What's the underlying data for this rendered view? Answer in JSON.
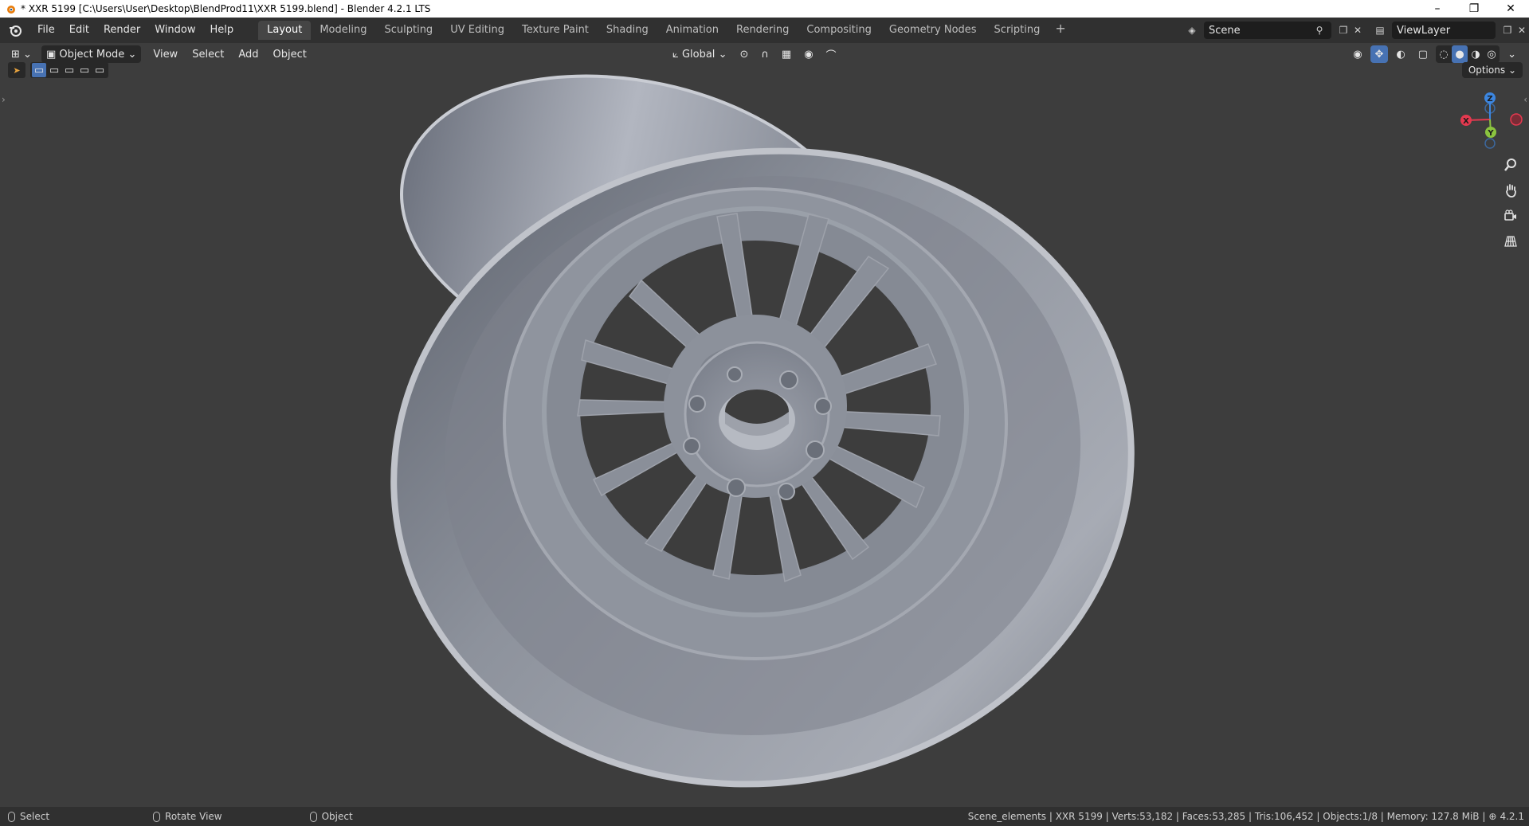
{
  "window": {
    "title": "* XXR 5199 [C:\\Users\\User\\Desktop\\BlendProd11\\XXR 5199.blend] - Blender 4.2.1 LTS",
    "minimize": "–",
    "restore": "❐",
    "close": "✕"
  },
  "topbar": {
    "menus": [
      "File",
      "Edit",
      "Render",
      "Window",
      "Help"
    ],
    "workspaces": [
      "Layout",
      "Modeling",
      "Sculpting",
      "UV Editing",
      "Texture Paint",
      "Shading",
      "Animation",
      "Rendering",
      "Compositing",
      "Geometry Nodes",
      "Scripting"
    ],
    "active_workspace": "Layout",
    "add_workspace": "+",
    "scene": "Scene",
    "view_layer": "ViewLayer"
  },
  "viewport_header": {
    "mode": "Object Mode",
    "menus": [
      "View",
      "Select",
      "Add",
      "Object"
    ],
    "transform_orientation": "Global",
    "options": "Options"
  },
  "gizmo": {
    "z": "Z",
    "y": "Y",
    "x": "X",
    "colors": {
      "x": "#e4394f",
      "y": "#8bc43f",
      "z": "#3c86e0"
    }
  },
  "statusbar": {
    "left": [
      {
        "label": "Select"
      },
      {
        "label": "Rotate View"
      },
      {
        "label": "Object"
      }
    ],
    "stats": "Scene_elements | XXR 5199 | Verts:53,182 | Faces:53,285 | Tris:106,452 | Objects:1/8 | Memory: 127.8 MiB |",
    "version": "4.2.1"
  },
  "colors": {
    "accent": "#4772b3",
    "viewport_bg": "#3d3d3d",
    "wheel": "#8e939e"
  }
}
